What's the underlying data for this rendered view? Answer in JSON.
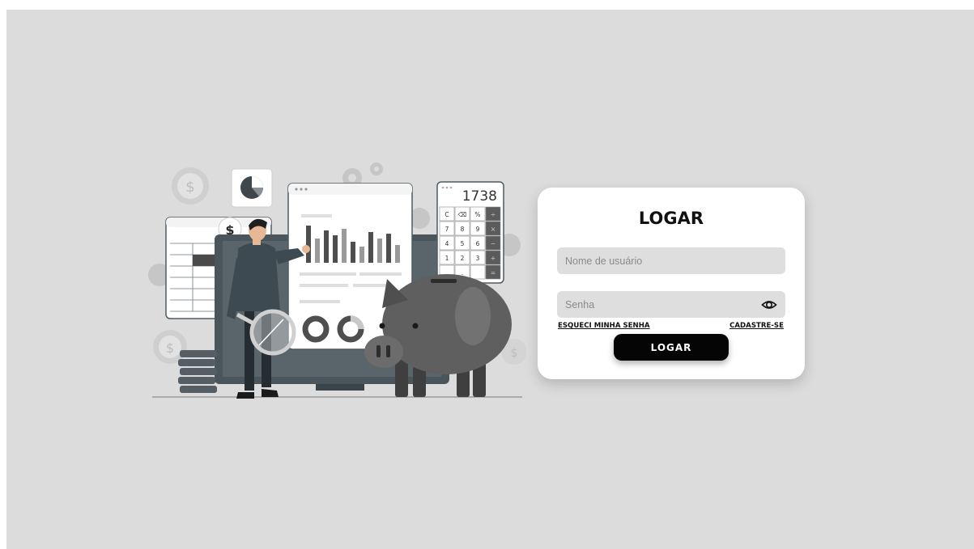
{
  "login": {
    "title": "LOGAR",
    "username_placeholder": "Nome de usuário",
    "password_placeholder": "Senha",
    "forgot_link": "ESQUECI MINHA SENHA",
    "signup_link": "CADASTRE-SE",
    "submit_label": "LOGAR"
  },
  "illustration": {
    "calculator_display": "1738",
    "calculator_keys": [
      "C",
      "⌫",
      "%",
      "÷",
      "7",
      "8",
      "9",
      "×",
      "4",
      "5",
      "6",
      "−",
      "1",
      "2",
      "3",
      "+",
      "",
      ".",
      "",
      "="
    ],
    "dollar_symbol": "$",
    "icons": [
      "dollar-coin-icon",
      "pie-chart-icon",
      "gear-icon",
      "magnifier-icon",
      "piggy-bank-icon"
    ]
  },
  "colors": {
    "background": "#dcdcdc",
    "card": "#ffffff",
    "button": "#050505",
    "field": "#dedede"
  }
}
